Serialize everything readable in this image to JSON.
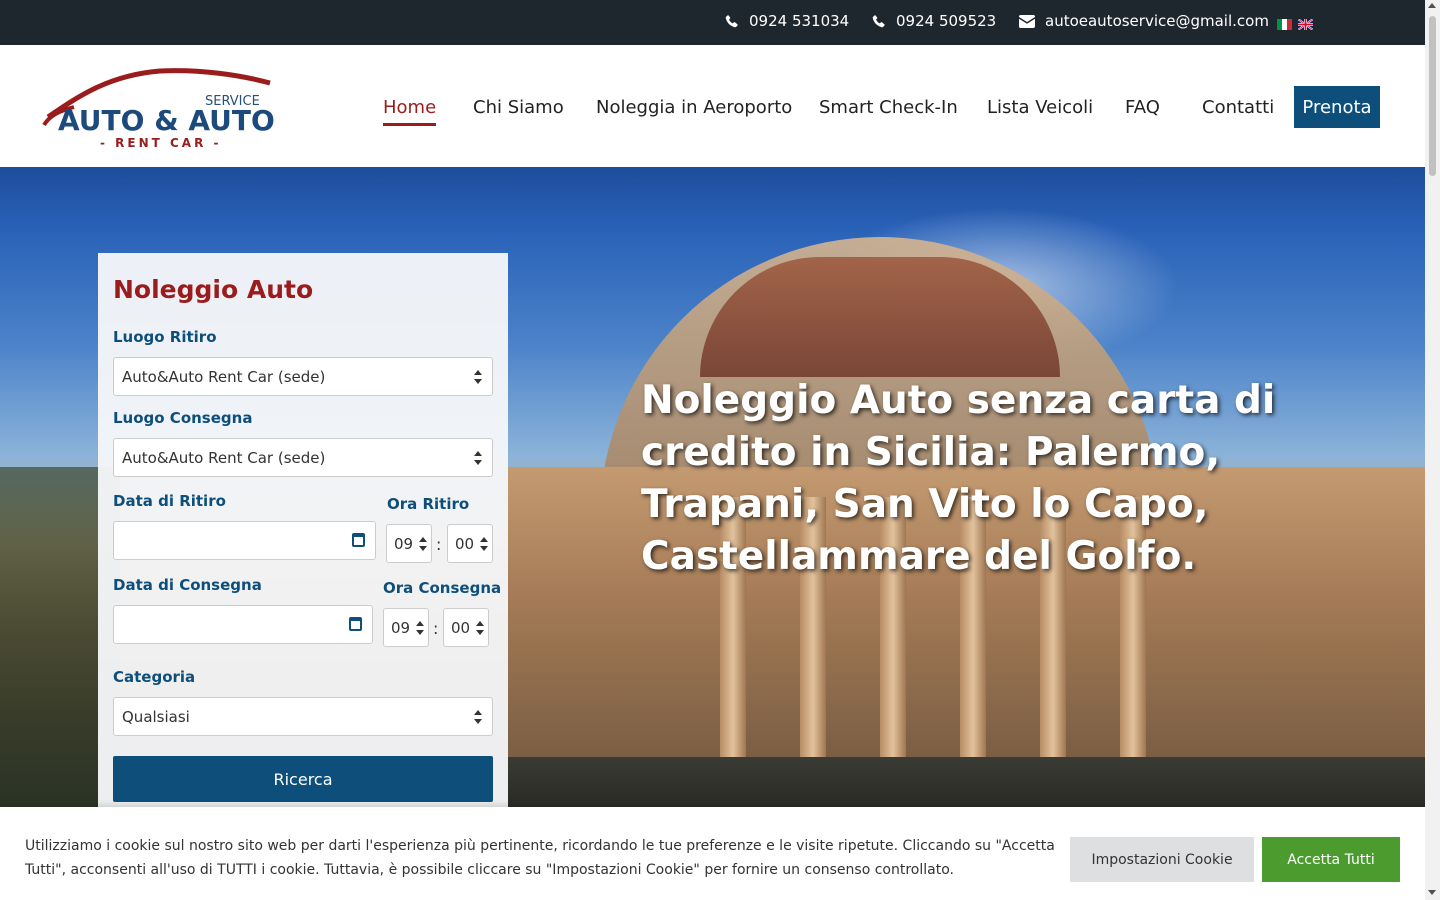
{
  "topbar": {
    "phone1": "0924 531034",
    "phone2": "0924 509523",
    "email": "autoeautoservice@gmail.com",
    "languages": [
      "it",
      "en"
    ]
  },
  "header": {
    "logo": {
      "line1": "SERVICE",
      "line2": "AUTO & AUTO",
      "line3": "- RENT CAR -"
    },
    "nav": [
      {
        "label": "Home",
        "active": true
      },
      {
        "label": "Chi Siamo"
      },
      {
        "label": "Noleggia in Aeroporto"
      },
      {
        "label": "Smart Check-In"
      },
      {
        "label": "Lista Veicoli"
      },
      {
        "label": "FAQ"
      },
      {
        "label": "Contatti"
      }
    ],
    "cta": "Prenota"
  },
  "hero": {
    "title": "Noleggio Auto senza carta di credito in Sicilia: Palermo, Trapani, San Vito lo Capo, Castellammare del Golfo."
  },
  "booking": {
    "title": "Noleggio Auto",
    "pickup_location_label": "Luogo Ritiro",
    "pickup_location_value": "Auto&Auto Rent Car (sede)",
    "return_location_label": "Luogo Consegna",
    "return_location_value": "Auto&Auto Rent Car (sede)",
    "pickup_date_label": "Data di Ritiro",
    "pickup_time_label": "Ora Ritiro",
    "pickup_hour": "09",
    "pickup_minute": "00",
    "return_date_label": "Data di Consegna",
    "return_time_label": "Ora Consegna",
    "return_hour": "09",
    "return_minute": "00",
    "category_label": "Categoria",
    "category_value": "Qualsiasi",
    "search_button": "Ricerca"
  },
  "cookie": {
    "text": "Utilizziamo i cookie sul nostro sito web per darti l'esperienza più pertinente, ricordando le tue preferenze e le visite ripetute. Cliccando su \"Accetta Tutti\", acconsenti all'uso di TUTTI i cookie. Tuttavia, è possibile cliccare su \"Impostazioni Cookie\" per fornire un consenso controllato.",
    "settings_button": "Impostazioni Cookie",
    "accept_button": "Accetta Tutti"
  },
  "colors": {
    "primary": "#0d4f7a",
    "accent": "#9b1c1c",
    "topbar": "#1f272e",
    "accept": "#4b9b2f"
  }
}
